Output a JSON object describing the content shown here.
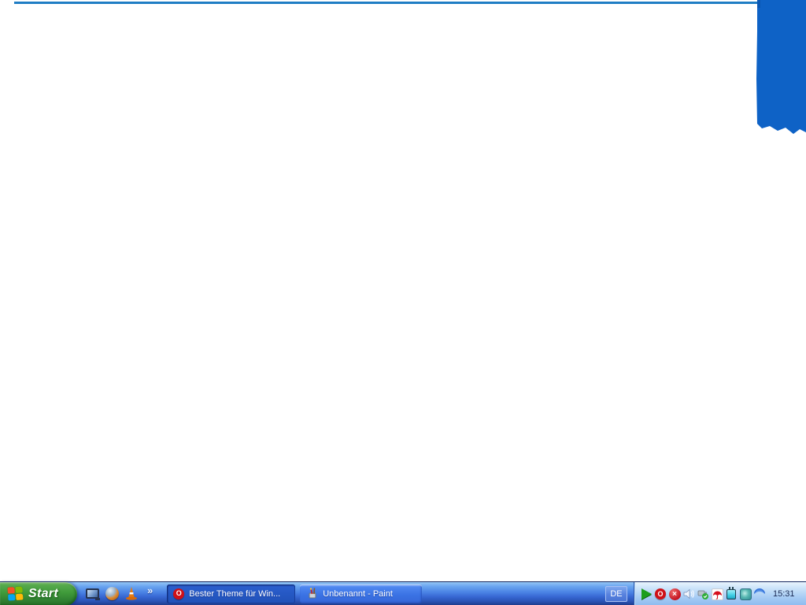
{
  "colors": {
    "canvas_background": "#ffffff",
    "top_line_blue": "#1f7dc4",
    "corner_shape_blue": "#0e62c6",
    "taskbar_blue_top": "#95c6f5",
    "taskbar_blue_bottom": "#1e3c8c",
    "start_green": "#3f9a3a",
    "tray_light_blue": "#cfe6fa",
    "opera_red": "#cf1018"
  },
  "taskbar": {
    "start": {
      "label": "Start"
    },
    "quick_launch": {
      "overflow_chevron": "»"
    },
    "window_buttons": [
      {
        "label": "Bester Theme für Win...",
        "icon": "opera-icon",
        "state": "active",
        "opera_letter": "O"
      },
      {
        "label": "Unbenannt - Paint",
        "icon": "paint-icon",
        "state": "inactive"
      }
    ],
    "language_indicator": {
      "label": "DE"
    },
    "tray": {
      "security_alert_glyph": "×",
      "clock": "15:31"
    }
  }
}
